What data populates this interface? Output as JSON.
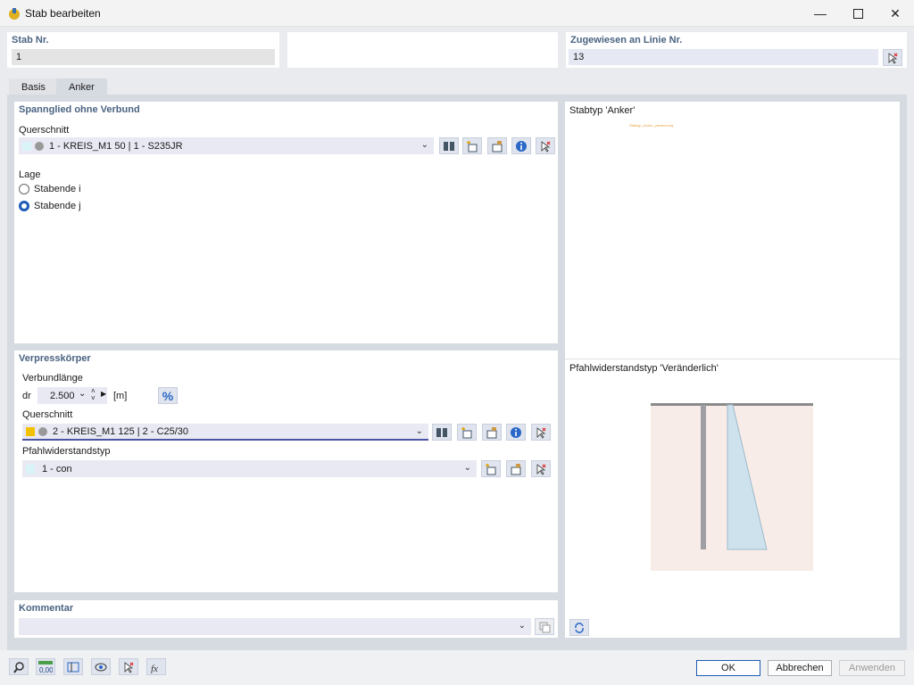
{
  "window": {
    "title": "Stab bearbeiten"
  },
  "header": {
    "stab_nr_label": "Stab Nr.",
    "stab_nr_value": "1",
    "zugewiesen_label": "Zugewiesen an Linie Nr.",
    "zugewiesen_value": "13"
  },
  "tabs": [
    {
      "label": "Basis"
    },
    {
      "label": "Anker"
    }
  ],
  "spannglied": {
    "title": "Spannglied ohne Verbund",
    "querschnitt_label": "Querschnitt",
    "querschnitt_value": "1 - KREIS_M1 50 | 1 - S235JR",
    "lage_label": "Lage",
    "options": [
      {
        "label": "Stabende i",
        "selected": false
      },
      {
        "label": "Stabende j",
        "selected": true
      }
    ]
  },
  "verpress": {
    "title": "Verpresskörper",
    "verbundlaenge_label": "Verbundlänge",
    "symbol": "dr",
    "length_value": "2.500",
    "unit": "[m]",
    "percent": "%",
    "querschnitt_label": "Querschnitt",
    "querschnitt_value": "2 - KREIS_M1 125 | 2 - C25/30",
    "pfahl_label": "Pfahlwiderstandstyp",
    "pfahl_value": "1 - con"
  },
  "kommentar": {
    "label": "Kommentar",
    "value": ""
  },
  "preview": {
    "stabtyp_title": "Stabtyp 'Anker'",
    "missing_image_text": "Stabtyp_Anker_preview.svg",
    "pfahl_title": "Pfahlwiderstandstyp 'Veränderlich'"
  },
  "buttons": {
    "ok": "OK",
    "cancel": "Abbrechen",
    "apply": "Anwenden"
  },
  "colors": {
    "accent": "#1e5bb5",
    "label_blue": "#4a6382",
    "swatch_yellow": "#f2c200",
    "swatch_cyan": "#d8f4f8"
  }
}
